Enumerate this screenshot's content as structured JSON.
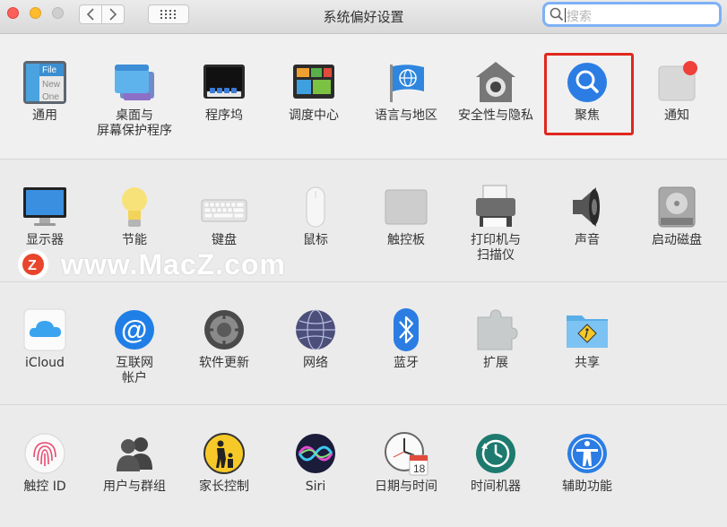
{
  "window": {
    "title": "系统偏好设置"
  },
  "search": {
    "placeholder": "搜索"
  },
  "rows": [
    [
      {
        "id": "general",
        "label": "通用",
        "icon": "general-icon"
      },
      {
        "id": "desktop",
        "label": "桌面与",
        "label2": "屏幕保护程序",
        "icon": "desktop-screensaver-icon"
      },
      {
        "id": "dock",
        "label": "程序坞",
        "icon": "dock-icon"
      },
      {
        "id": "mission",
        "label": "调度中心",
        "icon": "mission-control-icon"
      },
      {
        "id": "language",
        "label": "语言与地区",
        "icon": "language-region-icon"
      },
      {
        "id": "security",
        "label": "安全性与隐私",
        "icon": "security-privacy-icon"
      },
      {
        "id": "spotlight",
        "label": "聚焦",
        "icon": "spotlight-icon"
      },
      {
        "id": "notifications",
        "label": "通知",
        "icon": "notifications-icon"
      }
    ],
    [
      {
        "id": "displays",
        "label": "显示器",
        "icon": "display-icon"
      },
      {
        "id": "energy",
        "label": "节能",
        "icon": "energy-saver-icon"
      },
      {
        "id": "keyboard",
        "label": "键盘",
        "icon": "keyboard-icon"
      },
      {
        "id": "mouse",
        "label": "鼠标",
        "icon": "mouse-icon"
      },
      {
        "id": "trackpad",
        "label": "触控板",
        "icon": "trackpad-icon"
      },
      {
        "id": "printers",
        "label": "打印机与",
        "label2": "扫描仪",
        "icon": "printer-icon"
      },
      {
        "id": "sound",
        "label": "声音",
        "icon": "sound-icon"
      },
      {
        "id": "startup",
        "label": "启动磁盘",
        "icon": "startup-disk-icon"
      }
    ],
    [
      {
        "id": "icloud",
        "label": "iCloud",
        "icon": "icloud-icon"
      },
      {
        "id": "internet",
        "label": "互联网",
        "label2": "帐户",
        "icon": "internet-accounts-icon"
      },
      {
        "id": "update",
        "label": "软件更新",
        "icon": "software-update-icon"
      },
      {
        "id": "network",
        "label": "网络",
        "icon": "network-icon"
      },
      {
        "id": "bluetooth",
        "label": "蓝牙",
        "icon": "bluetooth-icon"
      },
      {
        "id": "extensions",
        "label": "扩展",
        "icon": "extensions-icon"
      },
      {
        "id": "sharing",
        "label": "共享",
        "icon": "sharing-icon"
      }
    ],
    [
      {
        "id": "touchid",
        "label": "触控 ID",
        "icon": "touch-id-icon"
      },
      {
        "id": "users",
        "label": "用户与群组",
        "icon": "users-groups-icon"
      },
      {
        "id": "parental",
        "label": "家长控制",
        "icon": "parental-controls-icon"
      },
      {
        "id": "siri",
        "label": "Siri",
        "icon": "siri-icon"
      },
      {
        "id": "datetime",
        "label": "日期与时间",
        "icon": "date-time-icon",
        "calendar_day": "18"
      },
      {
        "id": "timemachine",
        "label": "时间机器",
        "icon": "time-machine-icon"
      },
      {
        "id": "accessibility",
        "label": "辅助功能",
        "icon": "accessibility-icon"
      }
    ]
  ],
  "general_icon_text": [
    "File",
    "New",
    "One"
  ],
  "watermark": {
    "text": "www.MacZ.com",
    "logo_letter": "Z"
  },
  "colors": {
    "highlight": "#e0271d",
    "accent": "#2b7de3",
    "badge": "#f0403a"
  }
}
